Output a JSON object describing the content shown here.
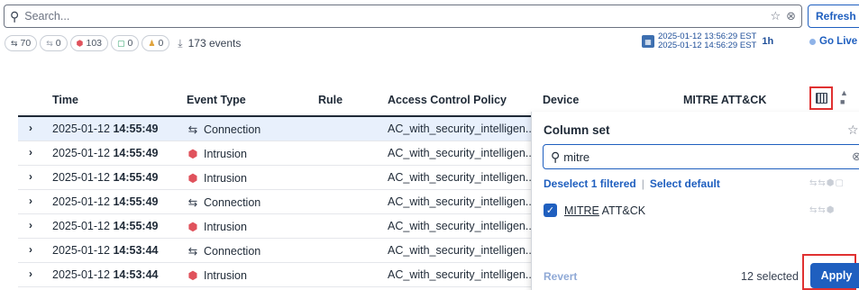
{
  "search": {
    "placeholder": "Search..."
  },
  "toolbar": {
    "refresh_label": "Refresh"
  },
  "chips": [
    {
      "icon": "⇆",
      "count": "70"
    },
    {
      "icon": "⇆",
      "count": "0"
    },
    {
      "icon": "⬢",
      "count": "103"
    },
    {
      "icon": "▢",
      "count": "0"
    },
    {
      "icon": "♟",
      "count": "0"
    }
  ],
  "events": {
    "label": "173 events"
  },
  "timerange": {
    "start": "2025-01-12 13:56:29 EST",
    "end": "2025-01-12 14:56:29 EST",
    "duration": "1h",
    "golive_label": "Go Live"
  },
  "table": {
    "headers": {
      "time": "Time",
      "event_type": "Event Type",
      "rule": "Rule",
      "acp": "Access Control Policy",
      "device": "Device",
      "mitre": "MITRE ATT&CK"
    },
    "rows": [
      {
        "date": "2025-01-12",
        "time": "14:55:49",
        "type": "Connection",
        "icon": "⇆",
        "policy": "AC_with_security_intelligen.."
      },
      {
        "date": "2025-01-12",
        "time": "14:55:49",
        "type": "Intrusion",
        "icon": "⬢",
        "policy": "AC_with_security_intelligen.."
      },
      {
        "date": "2025-01-12",
        "time": "14:55:49",
        "type": "Intrusion",
        "icon": "⬢",
        "policy": "AC_with_security_intelligen.."
      },
      {
        "date": "2025-01-12",
        "time": "14:55:49",
        "type": "Connection",
        "icon": "⇆",
        "policy": "AC_with_security_intelligen.."
      },
      {
        "date": "2025-01-12",
        "time": "14:55:49",
        "type": "Intrusion",
        "icon": "⬢",
        "policy": "AC_with_security_intelligen.."
      },
      {
        "date": "2025-01-12",
        "time": "14:53:44",
        "type": "Connection",
        "icon": "⇆",
        "policy": "AC_with_security_intelligen.."
      },
      {
        "date": "2025-01-12",
        "time": "14:53:44",
        "type": "Intrusion",
        "icon": "⬢",
        "policy": "AC_with_security_intelligen.."
      }
    ]
  },
  "column_set": {
    "title": "Column set",
    "query": "mitre",
    "deselect_label": "Deselect 1 filtered",
    "select_default_label": "Select default",
    "item_match": "MITRE",
    "item_rest": " ATT&CK",
    "revert_label": "Revert",
    "selected_count": "12 selected",
    "apply_label": "Apply"
  },
  "colors": {
    "accent": "#1f5fbf",
    "highlight": "#e03131",
    "intrusion": "#e0525c"
  }
}
